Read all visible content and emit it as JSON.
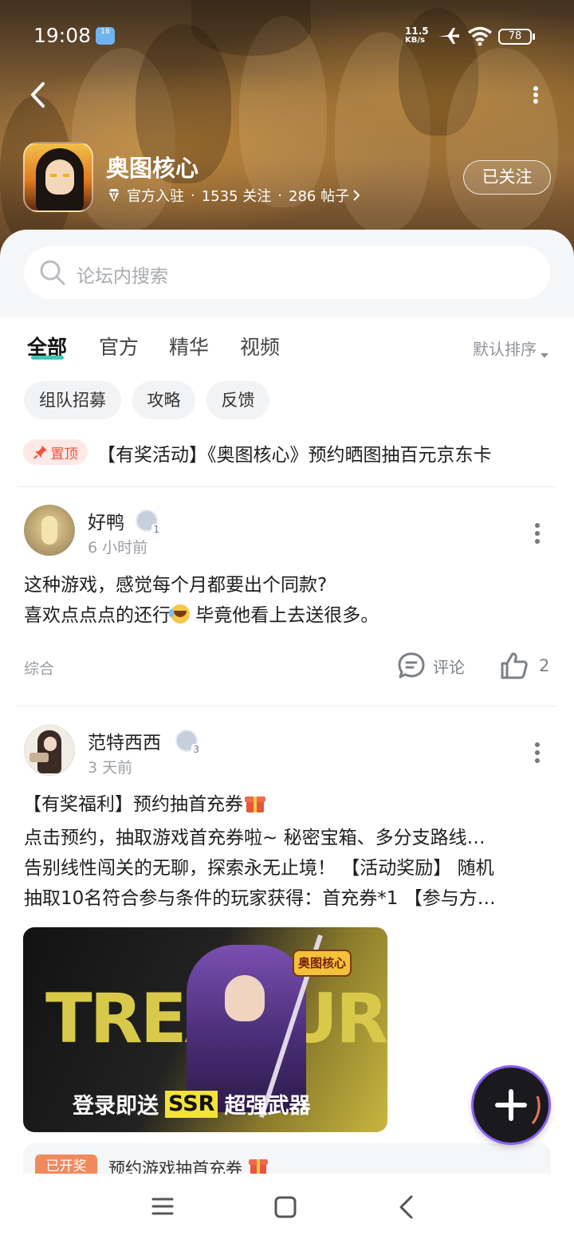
{
  "status_bar": {
    "time": "19:08",
    "weather_badge": "18",
    "net_speed_value": "11.5",
    "net_speed_unit": "KB/s",
    "battery": "78"
  },
  "forum": {
    "name": "奥图核心",
    "badge_text": "官方入驻",
    "separator": "·",
    "followers": "1535 关注",
    "posts": "286 帖子",
    "follow_button": "已关注"
  },
  "search": {
    "placeholder": "论坛内搜索"
  },
  "tabs": [
    {
      "label": "全部",
      "active": true
    },
    {
      "label": "官方",
      "active": false
    },
    {
      "label": "精华",
      "active": false
    },
    {
      "label": "视频",
      "active": false
    }
  ],
  "sort": {
    "label": "默认排序"
  },
  "chips": [
    "组队招募",
    "攻略",
    "反馈"
  ],
  "pinned": {
    "tag": "置顶",
    "title": "【有奖活动】《奥图核心》预约晒图抽百元京东卡"
  },
  "posts": [
    {
      "author": "好鸭",
      "level": "1",
      "time": "6 小时前",
      "line1": "这种游戏，感觉每个月都要出个同款?",
      "line2_a": "喜欢点点点的还行",
      "line2_b": " 毕竟他看上去送很多。",
      "category": "综合",
      "comment_label": "评论",
      "likes": "2"
    },
    {
      "author": "范特西西",
      "level": "3",
      "time": "3 天前",
      "title": "【有奖福利】预约抽首充券",
      "line1": "点击预约，抽取游戏首充券啦~ 秘密宝箱、多分支路线…",
      "line2": "告别线性闯关的无聊，探索永无止境！ 【活动奖励】 随机",
      "line3": "抽取10名符合参与条件的玩家获得：首充券*1 【参与方…",
      "banner": {
        "bg_text": "TREASURE",
        "logo": "奥图核心",
        "caption_a": "登录即送",
        "caption_ssr": "SSR",
        "caption_b": "超强武器"
      },
      "lottery_tag": "已开奖",
      "lottery_text": "预约游戏抽首充券"
    }
  ],
  "colors": {
    "accent_teal": "#3cc7b0",
    "pin_red": "#f0503c",
    "fab_ring": "#8a60f0"
  }
}
